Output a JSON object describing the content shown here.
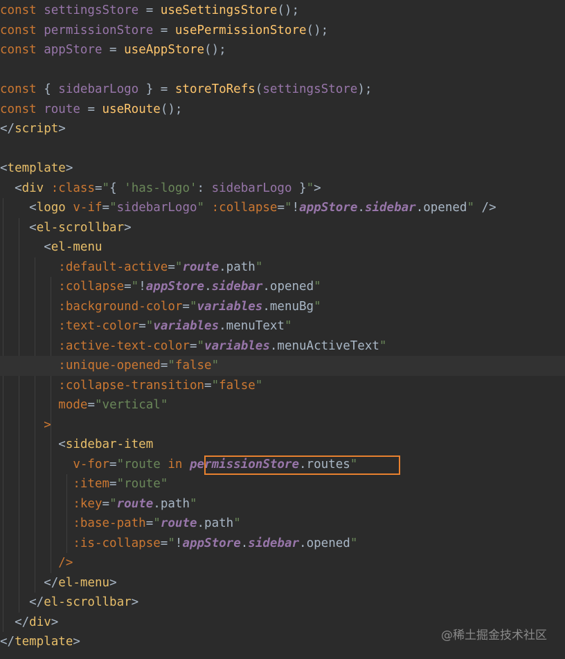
{
  "theme": {
    "background": "#2b2b2b",
    "current_line": "#323232",
    "highlight_box": "#e8812f",
    "colors": {
      "kw": "#cc7832",
      "var": "#9876aa",
      "fn": "#ffc66d",
      "punct": "#a9b7c6",
      "tag": "#e8bf6a",
      "attr": "#bababa",
      "str": "#6a8759",
      "strbody": "#a9b7c6",
      "ital": "#9876aa"
    }
  },
  "code_lines": [
    {
      "current": false,
      "tokens": [
        {
          "t": "const ",
          "c": "kw"
        },
        {
          "t": "settingsStore",
          "c": "var"
        },
        {
          "t": " = ",
          "c": "punct"
        },
        {
          "t": "useSettingsStore",
          "c": "fn"
        },
        {
          "t": "();",
          "c": "punct"
        }
      ]
    },
    {
      "current": false,
      "tokens": [
        {
          "t": "const ",
          "c": "kw"
        },
        {
          "t": "permissionStore",
          "c": "var"
        },
        {
          "t": " = ",
          "c": "punct"
        },
        {
          "t": "usePermissionStore",
          "c": "fn"
        },
        {
          "t": "();",
          "c": "punct"
        }
      ]
    },
    {
      "current": false,
      "tokens": [
        {
          "t": "const ",
          "c": "kw"
        },
        {
          "t": "appStore",
          "c": "var"
        },
        {
          "t": " = ",
          "c": "punct"
        },
        {
          "t": "useAppStore",
          "c": "fn"
        },
        {
          "t": "();",
          "c": "punct"
        }
      ]
    },
    {
      "current": false,
      "tokens": []
    },
    {
      "current": false,
      "tokens": [
        {
          "t": "const ",
          "c": "kw"
        },
        {
          "t": "{ ",
          "c": "punct"
        },
        {
          "t": "sidebarLogo",
          "c": "var"
        },
        {
          "t": " } = ",
          "c": "punct"
        },
        {
          "t": "storeToRefs",
          "c": "fn"
        },
        {
          "t": "(",
          "c": "punct"
        },
        {
          "t": "settingsStore",
          "c": "var"
        },
        {
          "t": ");",
          "c": "punct"
        }
      ]
    },
    {
      "current": false,
      "tokens": [
        {
          "t": "const ",
          "c": "kw"
        },
        {
          "t": "route",
          "c": "var"
        },
        {
          "t": " = ",
          "c": "punct"
        },
        {
          "t": "useRoute",
          "c": "fn"
        },
        {
          "t": "();",
          "c": "punct"
        }
      ]
    },
    {
      "current": false,
      "tokens": [
        {
          "t": "</",
          "c": "punct"
        },
        {
          "t": "script",
          "c": "tag"
        },
        {
          "t": ">",
          "c": "punct"
        }
      ]
    },
    {
      "current": false,
      "tokens": []
    },
    {
      "current": false,
      "tokens": [
        {
          "t": "<",
          "c": "punct"
        },
        {
          "t": "template",
          "c": "tag"
        },
        {
          "t": ">",
          "c": "punct"
        }
      ]
    },
    {
      "current": false,
      "tokens": [
        {
          "t": "  <",
          "c": "punct"
        },
        {
          "t": "div ",
          "c": "tag"
        },
        {
          "t": ":class",
          "c": "kw"
        },
        {
          "t": "=",
          "c": "punct"
        },
        {
          "t": "\"",
          "c": "str"
        },
        {
          "t": "{ ",
          "c": "strbody"
        },
        {
          "t": "'has-logo'",
          "c": "str"
        },
        {
          "t": ": ",
          "c": "strbody"
        },
        {
          "t": "sidebarLogo",
          "c": "var"
        },
        {
          "t": " }",
          "c": "strbody"
        },
        {
          "t": "\"",
          "c": "str"
        },
        {
          "t": ">",
          "c": "punct"
        }
      ]
    },
    {
      "current": false,
      "tokens": [
        {
          "t": "    <",
          "c": "punct"
        },
        {
          "t": "logo ",
          "c": "tag"
        },
        {
          "t": "v-if",
          "c": "kw"
        },
        {
          "t": "=",
          "c": "punct"
        },
        {
          "t": "\"",
          "c": "str"
        },
        {
          "t": "sidebarLogo",
          "c": "var"
        },
        {
          "t": "\"",
          "c": "str"
        },
        {
          "t": " ",
          "c": "punct"
        },
        {
          "t": ":collapse",
          "c": "kw"
        },
        {
          "t": "=",
          "c": "punct"
        },
        {
          "t": "\"",
          "c": "str"
        },
        {
          "t": "!",
          "c": "strbody"
        },
        {
          "t": "appStore",
          "c": "ital"
        },
        {
          "t": ".",
          "c": "strbody"
        },
        {
          "t": "sidebar",
          "c": "ital"
        },
        {
          "t": ".opened",
          "c": "strbody"
        },
        {
          "t": "\"",
          "c": "str"
        },
        {
          "t": " />",
          "c": "punct"
        }
      ]
    },
    {
      "current": false,
      "tokens": [
        {
          "t": "    <",
          "c": "punct"
        },
        {
          "t": "el-scrollbar",
          "c": "tag"
        },
        {
          "t": ">",
          "c": "punct"
        }
      ]
    },
    {
      "current": false,
      "tokens": [
        {
          "t": "      <",
          "c": "punct"
        },
        {
          "t": "el-menu",
          "c": "tag"
        }
      ]
    },
    {
      "current": false,
      "tokens": [
        {
          "t": "        ",
          "c": "punct"
        },
        {
          "t": ":default-active",
          "c": "kw"
        },
        {
          "t": "=",
          "c": "punct"
        },
        {
          "t": "\"",
          "c": "str"
        },
        {
          "t": "route",
          "c": "ital"
        },
        {
          "t": ".path",
          "c": "strbody"
        },
        {
          "t": "\"",
          "c": "str"
        }
      ]
    },
    {
      "current": false,
      "tokens": [
        {
          "t": "        ",
          "c": "punct"
        },
        {
          "t": ":collapse",
          "c": "kw"
        },
        {
          "t": "=",
          "c": "punct"
        },
        {
          "t": "\"",
          "c": "str"
        },
        {
          "t": "!",
          "c": "strbody"
        },
        {
          "t": "appStore",
          "c": "ital"
        },
        {
          "t": ".",
          "c": "strbody"
        },
        {
          "t": "sidebar",
          "c": "ital"
        },
        {
          "t": ".opened",
          "c": "strbody"
        },
        {
          "t": "\"",
          "c": "str"
        }
      ]
    },
    {
      "current": false,
      "tokens": [
        {
          "t": "        ",
          "c": "punct"
        },
        {
          "t": ":background-color",
          "c": "kw"
        },
        {
          "t": "=",
          "c": "punct"
        },
        {
          "t": "\"",
          "c": "str"
        },
        {
          "t": "variables",
          "c": "ital"
        },
        {
          "t": ".menuBg",
          "c": "strbody"
        },
        {
          "t": "\"",
          "c": "str"
        }
      ]
    },
    {
      "current": false,
      "tokens": [
        {
          "t": "        ",
          "c": "punct"
        },
        {
          "t": ":text-color",
          "c": "kw"
        },
        {
          "t": "=",
          "c": "punct"
        },
        {
          "t": "\"",
          "c": "str"
        },
        {
          "t": "variables",
          "c": "ital"
        },
        {
          "t": ".menuText",
          "c": "strbody"
        },
        {
          "t": "\"",
          "c": "str"
        }
      ]
    },
    {
      "current": false,
      "tokens": [
        {
          "t": "        ",
          "c": "punct"
        },
        {
          "t": ":active-text-color",
          "c": "kw"
        },
        {
          "t": "=",
          "c": "punct"
        },
        {
          "t": "\"",
          "c": "str"
        },
        {
          "t": "variables",
          "c": "ital"
        },
        {
          "t": ".menuActiveText",
          "c": "strbody"
        },
        {
          "t": "\"",
          "c": "str"
        }
      ]
    },
    {
      "current": true,
      "tokens": [
        {
          "t": "        ",
          "c": "punct"
        },
        {
          "t": ":unique-opened",
          "c": "kw"
        },
        {
          "t": "=",
          "c": "punct"
        },
        {
          "t": "\"",
          "c": "str"
        },
        {
          "t": "false",
          "c": "kw"
        },
        {
          "t": "\"",
          "c": "str"
        }
      ]
    },
    {
      "current": false,
      "tokens": [
        {
          "t": "        ",
          "c": "punct"
        },
        {
          "t": ":collapse-transition",
          "c": "kw"
        },
        {
          "t": "=",
          "c": "punct"
        },
        {
          "t": "\"",
          "c": "str"
        },
        {
          "t": "false",
          "c": "kw"
        },
        {
          "t": "\"",
          "c": "str"
        }
      ]
    },
    {
      "current": false,
      "tokens": [
        {
          "t": "        ",
          "c": "punct"
        },
        {
          "t": "mode",
          "c": "kw"
        },
        {
          "t": "=",
          "c": "punct"
        },
        {
          "t": "\"vertical\"",
          "c": "str"
        }
      ]
    },
    {
      "current": false,
      "tokens": [
        {
          "t": "      ",
          "c": "punct"
        },
        {
          "t": ">",
          "c": "kw"
        }
      ]
    },
    {
      "current": false,
      "tokens": [
        {
          "t": "        <",
          "c": "punct"
        },
        {
          "t": "sidebar-item",
          "c": "tag"
        }
      ]
    },
    {
      "current": false,
      "tokens": [
        {
          "t": "          ",
          "c": "punct"
        },
        {
          "t": "v-for",
          "c": "kw"
        },
        {
          "t": "=",
          "c": "punct"
        },
        {
          "t": "\"",
          "c": "str"
        },
        {
          "t": "route ",
          "c": "str"
        },
        {
          "t": "in ",
          "c": "kw"
        },
        {
          "t": "permissionStore",
          "c": "ital"
        },
        {
          "t": ".routes",
          "c": "strbody"
        },
        {
          "t": "\"",
          "c": "str"
        }
      ]
    },
    {
      "current": false,
      "tokens": [
        {
          "t": "          ",
          "c": "punct"
        },
        {
          "t": ":item",
          "c": "kw"
        },
        {
          "t": "=",
          "c": "punct"
        },
        {
          "t": "\"route\"",
          "c": "str"
        }
      ]
    },
    {
      "current": false,
      "tokens": [
        {
          "t": "          ",
          "c": "punct"
        },
        {
          "t": ":key",
          "c": "kw"
        },
        {
          "t": "=",
          "c": "punct"
        },
        {
          "t": "\"",
          "c": "str"
        },
        {
          "t": "route",
          "c": "ital"
        },
        {
          "t": ".path",
          "c": "strbody"
        },
        {
          "t": "\"",
          "c": "str"
        }
      ]
    },
    {
      "current": false,
      "tokens": [
        {
          "t": "          ",
          "c": "punct"
        },
        {
          "t": ":base-path",
          "c": "kw"
        },
        {
          "t": "=",
          "c": "punct"
        },
        {
          "t": "\"",
          "c": "str"
        },
        {
          "t": "route",
          "c": "ital"
        },
        {
          "t": ".path",
          "c": "strbody"
        },
        {
          "t": "\"",
          "c": "str"
        }
      ]
    },
    {
      "current": false,
      "tokens": [
        {
          "t": "          ",
          "c": "punct"
        },
        {
          "t": ":is-collapse",
          "c": "kw"
        },
        {
          "t": "=",
          "c": "punct"
        },
        {
          "t": "\"",
          "c": "str"
        },
        {
          "t": "!",
          "c": "strbody"
        },
        {
          "t": "appStore",
          "c": "ital"
        },
        {
          "t": ".",
          "c": "strbody"
        },
        {
          "t": "sidebar",
          "c": "ital"
        },
        {
          "t": ".opened",
          "c": "strbody"
        },
        {
          "t": "\"",
          "c": "str"
        }
      ]
    },
    {
      "current": false,
      "tokens": [
        {
          "t": "        ",
          "c": "punct"
        },
        {
          "t": "/>",
          "c": "kw"
        }
      ]
    },
    {
      "current": false,
      "tokens": [
        {
          "t": "      </",
          "c": "punct"
        },
        {
          "t": "el-menu",
          "c": "tag"
        },
        {
          "t": ">",
          "c": "punct"
        }
      ]
    },
    {
      "current": false,
      "tokens": [
        {
          "t": "    </",
          "c": "punct"
        },
        {
          "t": "el-scrollbar",
          "c": "tag"
        },
        {
          "t": ">",
          "c": "punct"
        }
      ]
    },
    {
      "current": false,
      "tokens": [
        {
          "t": "  </",
          "c": "punct"
        },
        {
          "t": "div",
          "c": "tag"
        },
        {
          "t": ">",
          "c": "punct"
        }
      ]
    },
    {
      "current": false,
      "tokens": [
        {
          "t": "</",
          "c": "punct"
        },
        {
          "t": "template",
          "c": "tag"
        },
        {
          "t": ">",
          "c": "punct"
        }
      ]
    }
  ],
  "watermark": "@稀土掘金技术社区"
}
